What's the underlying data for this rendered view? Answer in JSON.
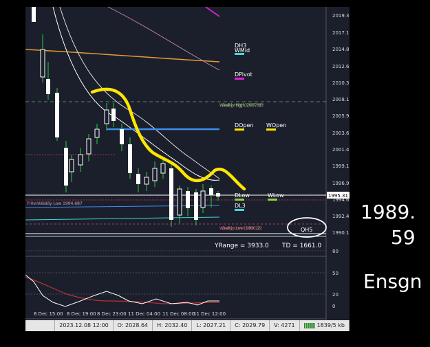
{
  "price_axis": {
    "ticks": [
      "2019.35",
      "2017.10",
      "2014.85",
      "2012.60",
      "2010.35",
      "2008.15",
      "2005.90",
      "2003.65",
      "2001.40",
      "1999.15",
      "1996.90",
      "1994.65",
      "1992.40",
      "1990.15"
    ],
    "current_price": "1995.31"
  },
  "level_labels": {
    "dh3": "DH3",
    "wmid": "WMid",
    "dpivot": "DPivot",
    "dopen": "DOpen",
    "wopen": "WOpen",
    "dlow": "DLow",
    "wlow": "WLow",
    "dl3": "DL3",
    "qh5": "QH5",
    "weekly_high": "Weekly High 2007.83",
    "daily_high": "Daily High 2007.83",
    "weekly_low": "Weekly Low 1990.22",
    "daily_low": "Daily Low 1990.22",
    "prev_weekly_low": "Prev Weekly Low 1994.687",
    "prev_daily_low": "Prev Daily Low 1994.687"
  },
  "range_info": {
    "yrange": "YRange = 3933.0",
    "td": "TD = 1661.0"
  },
  "indicator_axis": {
    "ticks": [
      "80",
      "50",
      "20",
      "0"
    ]
  },
  "time_axis": {
    "ticks": [
      "8 Dec 15:00",
      "8 Dec 19:00",
      "8 Dec 23:00",
      "11 Dec 04:00",
      "11 Dec 08:00",
      "11 Dec 12:00"
    ]
  },
  "status_bar": {
    "datetime": "2023.12.08 12:00",
    "open": "O: 2028.64",
    "high": "H: 2032.40",
    "low": "L: 2027.21",
    "close": "C: 2029.79",
    "volume": "V: 4271",
    "traffic": "1839/5 kb"
  },
  "handwritten_notes": {
    "line1": "1989.",
    "line2": "59",
    "line3": "Ensgn"
  },
  "colors": {
    "background": "#1b1f2c",
    "candle": "#ffffff",
    "wick_green": "#2ecc40",
    "yellow_drawing": "#ffe600",
    "orange_line": "#e69a2e",
    "blue_line": "#3b8ff0",
    "pink_line": "#d08fb0",
    "magenta": "#e020d0",
    "red_line": "#c03030"
  }
}
